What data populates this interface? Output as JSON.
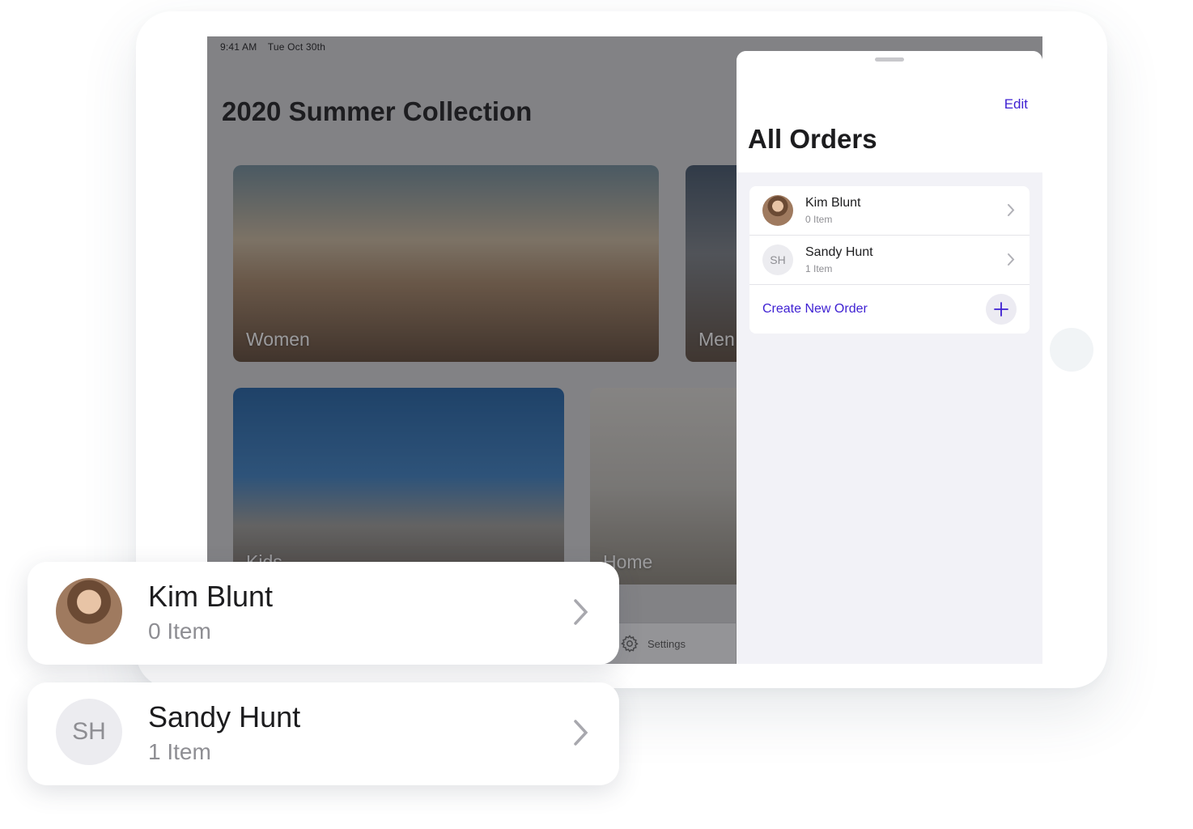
{
  "status_bar": {
    "time": "9:41 AM",
    "date": "Tue Oct 30th"
  },
  "catalog": {
    "title": "2020 Summer Collection",
    "categories": [
      {
        "label": "Women"
      },
      {
        "label": "Men"
      },
      {
        "label": "Kids"
      },
      {
        "label": "Home"
      }
    ]
  },
  "tab_bar": {
    "settings_label": "Settings",
    "settings_icon": "gear-icon"
  },
  "orders_panel": {
    "edit_label": "Edit",
    "title": "All Orders",
    "orders": [
      {
        "name": "Kim Blunt",
        "items": "0 Item",
        "avatar": "photo"
      },
      {
        "name": "Sandy Hunt",
        "items": "1 Item",
        "avatar_initials": "SH"
      }
    ],
    "create_label": "Create New Order"
  },
  "highlight_cards": [
    {
      "name": "Kim Blunt",
      "items": "0 Item",
      "avatar": "photo"
    },
    {
      "name": "Sandy Hunt",
      "items": "1 Item",
      "avatar_initials": "SH"
    }
  ],
  "colors": {
    "accent": "#3d1fd2",
    "secondary_text": "#8e8e93"
  }
}
